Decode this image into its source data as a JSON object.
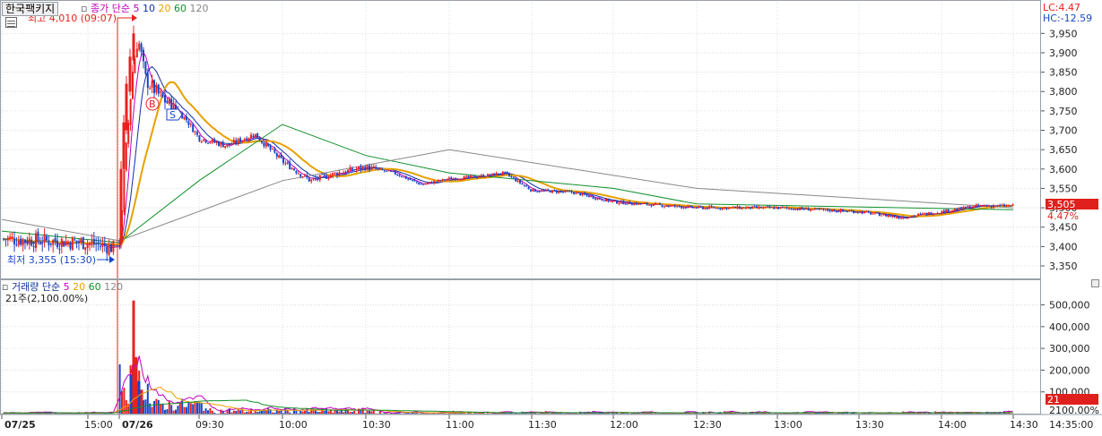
{
  "header": {
    "stock_name": "한국팩키지",
    "price_ma_label": "종가 단순",
    "ma_periods": [
      "5",
      "10",
      "20",
      "60",
      "120"
    ],
    "lc_label": "LC:4.47",
    "hc_label": "HC:-12.59",
    "high_marker": "최고 4,010 (09:07)",
    "low_marker": "최저 3,355 (15:30)",
    "buy_marker": "B",
    "sell_marker": "S"
  },
  "volume_header": {
    "title": "거래량 단순",
    "ma_periods": [
      "5",
      "20",
      "60",
      "120"
    ],
    "sub_label": "21주(2,100.00%)"
  },
  "price_axis": {
    "ticks": [
      "3,950",
      "3,900",
      "3,850",
      "3,800",
      "3,750",
      "3,700",
      "3,650",
      "3,600",
      "3,550",
      "3,500",
      "3,450",
      "3,400",
      "3,350"
    ],
    "current_price": "3,505",
    "current_change": "4.47%"
  },
  "volume_axis": {
    "ticks": [
      "500,000",
      "400,000",
      "300,000",
      "200,000",
      "100,000"
    ],
    "current_volume": "21",
    "bottom_label": "2100.00%"
  },
  "time_axis": {
    "labels": [
      "07/25",
      "15:00",
      "07/26",
      "09:30",
      "10:00",
      "10:30",
      "11:00",
      "11:30",
      "12:00",
      "12:30",
      "13:00",
      "13:30",
      "14:00",
      "14:30"
    ],
    "corner_label": "14:35:00"
  },
  "colors": {
    "up": "#e8211e",
    "down": "#1846c8",
    "ma5": "#c000c0",
    "ma10": "#1030a0",
    "ma20": "#e8a000",
    "ma60": "#10902a",
    "ma120": "#888888",
    "current_box": "#e0201c",
    "grid": "#d8dce0"
  },
  "chart_data": {
    "type": "candlestick",
    "title": "한국팩키지",
    "x_unit": "time (minute bars)",
    "y_unit": "KRW",
    "ylim": [
      3320,
      3990
    ],
    "volume_ylim": [
      0,
      560000
    ],
    "high": {
      "value": 4010,
      "time": "07/26 09:07"
    },
    "low": {
      "value": 3355,
      "time": "07/25 15:30"
    },
    "current_price": 3505,
    "change_pct": 4.47,
    "price_path": [
      [
        "07/25 14:35",
        3420
      ],
      [
        "07/25 15:00",
        3410
      ],
      [
        "07/25 15:30",
        3395
      ],
      [
        "07/26 09:00",
        3400
      ],
      [
        "07/26 09:02",
        3600
      ],
      [
        "07/26 09:05",
        3850
      ],
      [
        "07/26 09:07",
        3940
      ],
      [
        "07/26 09:10",
        3830
      ],
      [
        "07/26 09:15",
        3790
      ],
      [
        "07/26 09:20",
        3760
      ],
      [
        "07/26 09:25",
        3730
      ],
      [
        "07/26 09:30",
        3680
      ],
      [
        "07/26 09:40",
        3660
      ],
      [
        "07/26 09:50",
        3690
      ],
      [
        "07/26 10:00",
        3620
      ],
      [
        "07/26 10:10",
        3570
      ],
      [
        "07/26 10:20",
        3590
      ],
      [
        "07/26 10:30",
        3605
      ],
      [
        "07/26 10:40",
        3590
      ],
      [
        "07/26 10:50",
        3560
      ],
      [
        "07/26 11:00",
        3575
      ],
      [
        "07/26 11:10",
        3580
      ],
      [
        "07/26 11:20",
        3590
      ],
      [
        "07/26 11:30",
        3545
      ],
      [
        "07/26 11:45",
        3540
      ],
      [
        "07/26 12:00",
        3515
      ],
      [
        "07/26 12:30",
        3500
      ],
      [
        "07/26 13:00",
        3500
      ],
      [
        "07/26 13:30",
        3490
      ],
      [
        "07/26 13:45",
        3475
      ],
      [
        "07/26 14:00",
        3490
      ],
      [
        "07/26 14:15",
        3505
      ],
      [
        "07/26 14:30",
        3505
      ]
    ],
    "ma120_path": [
      [
        "07/25 14:35",
        3470
      ],
      [
        "07/26 09:00",
        3415
      ],
      [
        "07/26 10:00",
        3570
      ],
      [
        "07/26 11:00",
        3650
      ],
      [
        "07/26 12:30",
        3550
      ],
      [
        "07/26 14:30",
        3500
      ]
    ],
    "ma60_path": [
      [
        "07/25 14:35",
        3440
      ],
      [
        "07/26 09:00",
        3410
      ],
      [
        "07/26 09:30",
        3570
      ],
      [
        "07/26 10:00",
        3715
      ],
      [
        "07/26 10:30",
        3635
      ],
      [
        "07/26 11:00",
        3590
      ],
      [
        "07/26 12:00",
        3550
      ],
      [
        "07/26 12:30",
        3510
      ],
      [
        "07/26 14:30",
        3495
      ]
    ],
    "volume_notes": "peak minute volume ~520,000 at 07/26 09:07; low volume after 10:30",
    "grid": true
  }
}
